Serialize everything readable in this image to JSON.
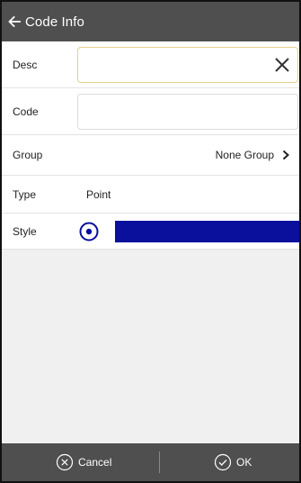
{
  "header": {
    "title": "Code Info",
    "back_icon": "arrow-left-icon"
  },
  "form": {
    "desc": {
      "label": "Desc",
      "value": "",
      "clear_icon": "close-icon"
    },
    "code": {
      "label": "Code",
      "value": ""
    },
    "group": {
      "label": "Group",
      "value": "None Group",
      "chevron_icon": "chevron-right-icon"
    },
    "type": {
      "label": "Type",
      "value": "Point"
    },
    "style": {
      "label": "Style",
      "radio_icon": "radio-selected-icon",
      "color": "#0a0f9c"
    }
  },
  "footer": {
    "cancel_label": "Cancel",
    "cancel_icon": "circle-x-icon",
    "ok_label": "OK",
    "ok_icon": "circle-check-icon"
  },
  "colors": {
    "bar_background": "#4f4f4f",
    "content_background": "#f0f0f0",
    "focus_border": "#e8cf8a"
  }
}
